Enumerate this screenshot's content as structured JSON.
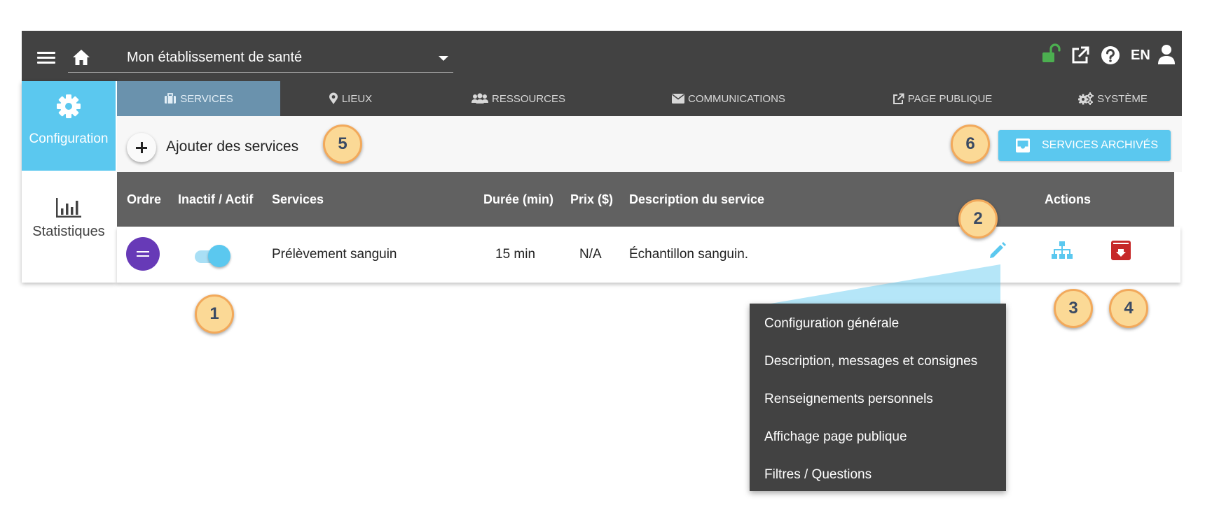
{
  "header": {
    "organization": "Mon établissement de santé",
    "language": "EN",
    "icons": [
      "menu-icon",
      "home-icon",
      "lock-open-icon",
      "external-link-icon",
      "help-icon",
      "user-icon"
    ],
    "lock_color": "#4caf50"
  },
  "sidebar": {
    "items": [
      {
        "label": "Configuration",
        "icon": "gear-icon",
        "active": true
      },
      {
        "label": "Statistiques",
        "icon": "bar-chart-icon",
        "active": false
      }
    ]
  },
  "tabs": [
    {
      "label": "SERVICES",
      "icon": "briefcase-icon",
      "active": true
    },
    {
      "label": "LIEUX",
      "icon": "map-marker-icon",
      "active": false
    },
    {
      "label": "RESSOURCES",
      "icon": "users-icon",
      "active": false
    },
    {
      "label": "COMMUNICATIONS",
      "icon": "envelope-icon",
      "active": false
    },
    {
      "label": "PAGE PUBLIQUE",
      "icon": "external-link-icon",
      "active": false
    },
    {
      "label": "SYSTÈME",
      "icon": "gears-icon",
      "active": false
    }
  ],
  "toolbar": {
    "add_label": "Ajouter des services",
    "archive_label": "SERVICES ARCHIVÉS"
  },
  "table": {
    "headers": [
      "Ordre",
      "Inactif / Actif",
      "Services",
      "Durée (min)",
      "Prix ($)",
      "Description du service",
      "Actions"
    ],
    "rows": [
      {
        "active": true,
        "service": "Prélèvement sanguin",
        "duration": "15 min",
        "price": "N/A",
        "description": "Échantillon sanguin.",
        "actions": [
          "pencil-icon",
          "sitemap-icon",
          "archive-icon"
        ]
      }
    ]
  },
  "dropdown": {
    "items": [
      "Configuration générale",
      "Description, messages et consignes",
      "Renseignements personnels",
      "Affichage page publique",
      "Filtres / Questions"
    ]
  },
  "callouts": [
    "1",
    "2",
    "3",
    "4",
    "5",
    "6"
  ],
  "colors": {
    "accent": "#5bc8ef",
    "header_bg": "#424242",
    "order_button": "#673ab7",
    "archive_action": "#c62828",
    "callout_fill": "#fbd996",
    "callout_border": "#f2a95b"
  }
}
